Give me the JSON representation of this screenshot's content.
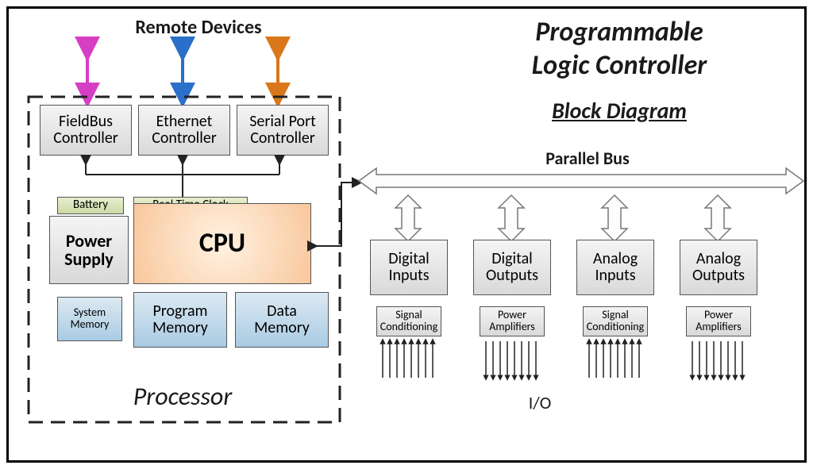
{
  "title_line1": "Programmable",
  "title_line2": "Logic Controller",
  "subtitle": "Block Diagram",
  "remote_devices": "Remote Devices",
  "processor_label": "Processor",
  "parallel_bus": "Parallel Bus",
  "io_label": "I/O",
  "comm": {
    "fieldbus": "FieldBus Controller",
    "ethernet": "Ethernet Controller",
    "serial": "Serial Port Controller"
  },
  "core": {
    "battery": "Battery",
    "rtc": "Real Time Clock",
    "power": "Power Supply",
    "cpu": "CPU",
    "sysmem": "System Memory",
    "progmem": "Program Memory",
    "datamem": "Data Memory"
  },
  "io": {
    "dig_in": "Digital Inputs",
    "dig_out": "Digital Outputs",
    "ana_in": "Analog Inputs",
    "ana_out": "Analog Outputs",
    "sig_cond": "Signal Conditioning",
    "pow_amp": "Power Amplifiers"
  }
}
